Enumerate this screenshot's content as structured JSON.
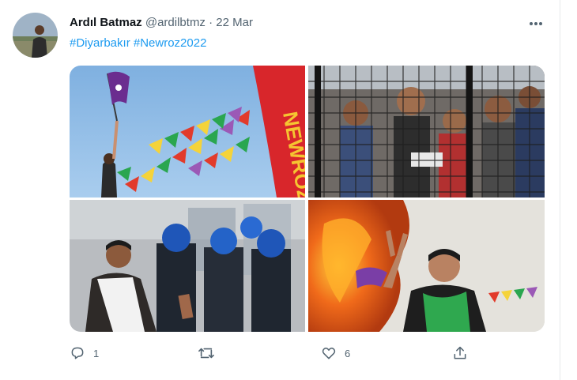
{
  "tweet": {
    "author_name": "Ardıl Batmaz",
    "handle": "@ardilbtmz",
    "separator": "·",
    "date": "22 Mar",
    "hashtags": "#Diyarbakır #Newroz2022",
    "more_icon": "more-horizontal-icon"
  },
  "media": {
    "photos": [
      {
        "description": "flags",
        "banner_text": "NEWROZ"
      },
      {
        "description": "crowd behind fence"
      },
      {
        "description": "riot police"
      },
      {
        "description": "fire and victory sign"
      }
    ]
  },
  "actions": {
    "reply_count": "1",
    "retweet_count": "",
    "like_count": "6",
    "icons": [
      "reply-icon",
      "retweet-icon",
      "like-icon",
      "share-icon"
    ]
  },
  "colors": {
    "link": "#1d9bf0",
    "secondary_text": "#536471",
    "border": "#e6e9eb"
  }
}
